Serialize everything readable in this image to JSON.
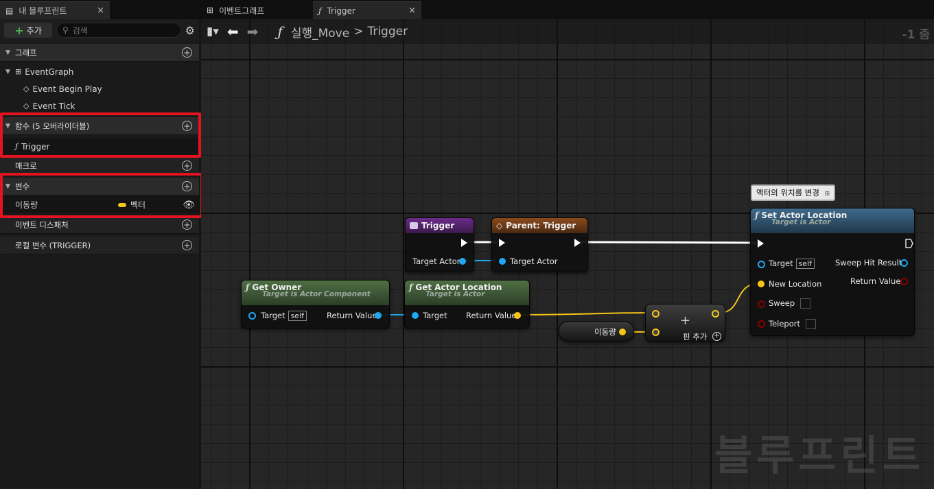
{
  "tabs": {
    "my_blueprint": "내 블루프린트",
    "event_graph": "이벤트그래프",
    "trigger": "Trigger",
    "close": "×"
  },
  "left_toolbar": {
    "add_label": "추가",
    "search_placeholder": "검색"
  },
  "sections": {
    "graphs": "그래프",
    "event_graph": "EventGraph",
    "event_begin_play": "Event Begin Play",
    "event_tick": "Event Tick",
    "functions": "함수 (5 오버라이더블)",
    "function_trigger": "Trigger",
    "macros": "매크로",
    "variables": "변수",
    "var_name": "이동량",
    "var_type": "벡터",
    "event_dispatchers": "이벤트 디스패처",
    "local_vars": "로컬 변수 (TRIGGER)"
  },
  "graph_toolbar": {
    "breadcrumb_root": "실행_Move",
    "breadcrumb_sep": ">",
    "breadcrumb_leaf": "Trigger",
    "zoom": "-1 줌"
  },
  "nodes": {
    "trigger": {
      "title": "Trigger",
      "pin_target_actor": "Target Actor"
    },
    "parent_trigger": {
      "title": "Parent: Trigger",
      "pin_target_actor": "Target Actor"
    },
    "get_owner": {
      "title": "Get Owner",
      "subtitle": "Target is Actor Component",
      "pin_target": "Target",
      "self": "self",
      "pin_return": "Return Value"
    },
    "get_actor_location": {
      "title": "Get Actor Location",
      "subtitle": "Target is Actor",
      "pin_target": "Target",
      "pin_return": "Return Value"
    },
    "set_actor_location": {
      "title": "Set Actor Location",
      "subtitle": "Target is Actor",
      "pin_target": "Target",
      "self": "self",
      "pin_new_location": "New Location",
      "pin_sweep": "Sweep",
      "pin_teleport": "Teleport",
      "pin_sweep_hit": "Sweep Hit Result",
      "pin_return": "Return Value"
    },
    "comment": "액터의 위치를 변경",
    "var_get": "이동량",
    "add_node": {
      "symbol": "+",
      "add_pin": "핀 추가"
    }
  },
  "watermark": "블루프린트",
  "colors": {
    "highlight": "#e3141f",
    "exec_wire": "#ffffff",
    "object_pin": "#1fa7f0",
    "vector_pin": "#f5c518",
    "bool_pin": "#8a0000"
  }
}
